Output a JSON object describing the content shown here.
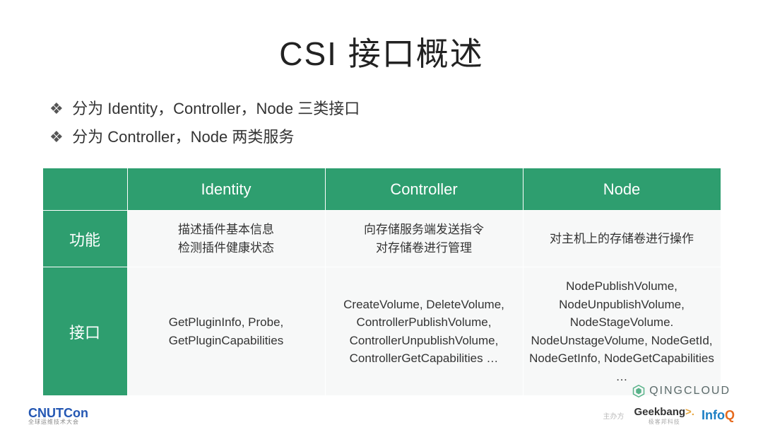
{
  "title": "CSI 接口概述",
  "bullets": [
    "分为 Identity，Controller，Node 三类接口",
    "分为 Controller，Node 两类服务"
  ],
  "table": {
    "headers": [
      "Identity",
      "Controller",
      "Node"
    ],
    "rows": [
      {
        "label": "功能",
        "cells": [
          "描述插件基本信息\n检测插件健康状态",
          "向存储服务端发送指令\n对存储卷进行管理",
          "对主机上的存储卷进行操作"
        ]
      },
      {
        "label": "接口",
        "cells": [
          "GetPluginInfo, Probe, GetPluginCapabilities",
          "CreateVolume, DeleteVolume, ControllerPublishVolume, ControllerUnpublishVolume, ControllerGetCapabilities …",
          "NodePublishVolume, NodeUnpublishVolume, NodeStageVolume. NodeUnstageVolume, NodeGetId, NodeGetInfo, NodeGetCapabilities …"
        ]
      }
    ]
  },
  "logos": {
    "qingcloud": "QINGCLOUD",
    "cnutcon": "CNUTCon",
    "cnutcon_sub": "全球运维技术大会",
    "sponsor_label": "主办方",
    "geekbang": "Geekbang",
    "geekbang_sub": "极客邦科技",
    "infoq_a": "Info",
    "infoq_b": "Q"
  }
}
